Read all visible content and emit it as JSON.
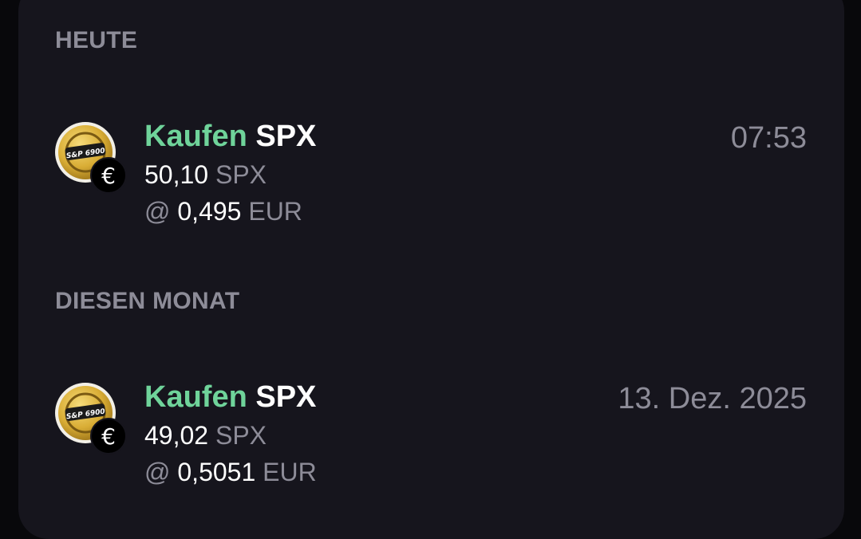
{
  "sections": [
    {
      "header": "HEUTE",
      "transaction": {
        "action": "Kaufen",
        "asset": "SPX",
        "amount": "50,10",
        "amount_unit": "SPX",
        "price_prefix": "@",
        "price": "0,495",
        "price_unit": "EUR",
        "time": "07:53",
        "badge_symbol": "€",
        "coin_text": "S&P 6900"
      }
    },
    {
      "header": "DIESEN MONAT",
      "transaction": {
        "action": "Kaufen",
        "asset": "SPX",
        "amount": "49,02",
        "amount_unit": "SPX",
        "price_prefix": "@",
        "price": "0,5051",
        "price_unit": "EUR",
        "time": "13. Dez. 2025",
        "badge_symbol": "€",
        "coin_text": "S&P 6900"
      }
    }
  ],
  "colors": {
    "background": "#08080b",
    "panel": "#16151d",
    "action_green": "#6fd39a",
    "muted_text": "#8d8c98",
    "primary_text": "#ffffff",
    "coin_gold": "#e0b840"
  },
  "icons": [
    "spx-coin-icon",
    "euro-badge-icon"
  ]
}
